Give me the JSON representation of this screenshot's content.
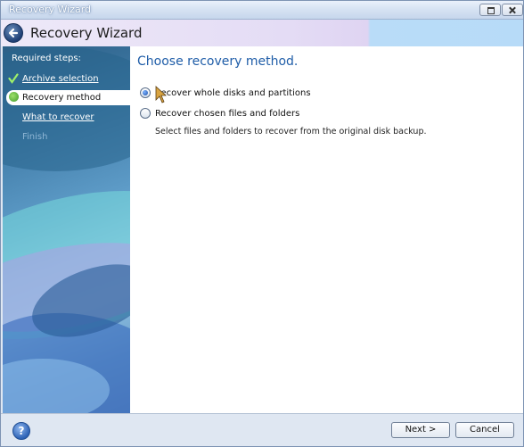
{
  "window": {
    "title": "Recovery Wizard"
  },
  "header": {
    "title": "Recovery Wizard"
  },
  "sidebar": {
    "label": "Required steps:",
    "steps": [
      {
        "label": "Archive selection",
        "state": "done"
      },
      {
        "label": "Recovery method",
        "state": "current"
      },
      {
        "label": "What to recover",
        "state": "next"
      },
      {
        "label": "Finish",
        "state": "disabled"
      }
    ]
  },
  "main": {
    "title": "Choose recovery method.",
    "options": [
      {
        "label": "Recover whole disks and partitions",
        "selected": true
      },
      {
        "label": "Recover chosen files and folders",
        "selected": false
      }
    ],
    "description": "Select files and folders to recover from the original disk backup."
  },
  "footer": {
    "next_label": "Next >",
    "cancel_label": "Cancel",
    "help_icon": "?"
  },
  "colors": {
    "accent": "#1f5da8",
    "title_text": "#ffffff"
  }
}
